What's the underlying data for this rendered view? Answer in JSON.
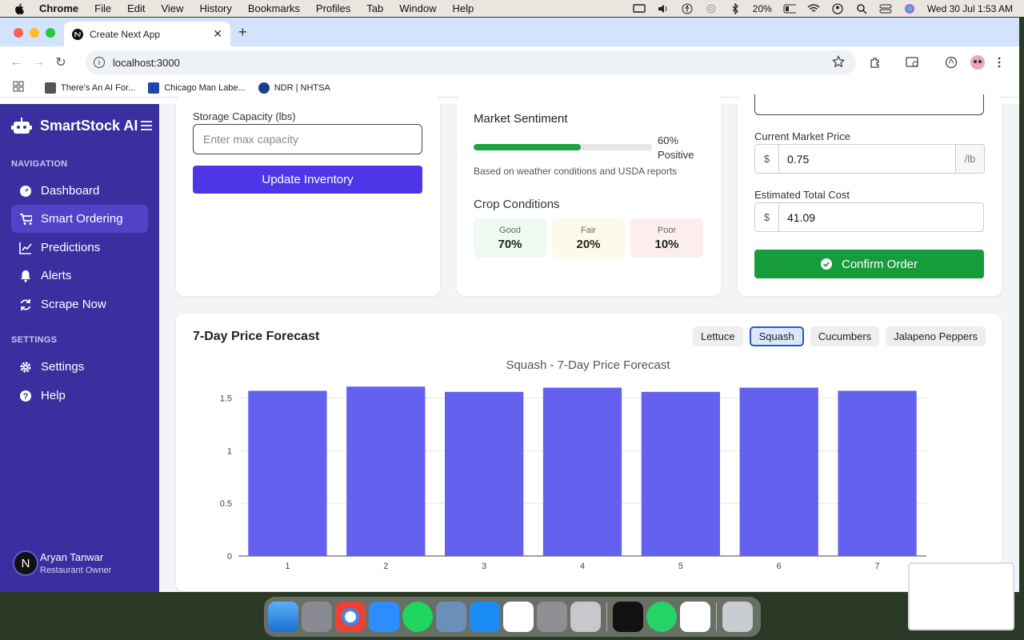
{
  "menubar": {
    "app": "Chrome",
    "items": [
      "File",
      "Edit",
      "View",
      "History",
      "Bookmarks",
      "Profiles",
      "Tab",
      "Window",
      "Help"
    ],
    "battery": "20%",
    "datetime": "Wed 30 Jul  1:53 AM"
  },
  "browser": {
    "tab_title": "Create Next App",
    "url": "localhost:3000",
    "bookmarks": [
      "There's An AI For...",
      "Chicago Man Labe...",
      "NDR | NHTSA"
    ]
  },
  "sidebar": {
    "brand": "SmartStock AI",
    "nav_heading": "NAVIGATION",
    "nav_items": [
      {
        "label": "Dashboard",
        "icon": "dashboard-icon"
      },
      {
        "label": "Smart Ordering",
        "icon": "cart-icon"
      },
      {
        "label": "Predictions",
        "icon": "chart-line-icon"
      },
      {
        "label": "Alerts",
        "icon": "bell-icon"
      },
      {
        "label": "Scrape Now",
        "icon": "refresh-icon"
      }
    ],
    "settings_heading": "SETTINGS",
    "settings_items": [
      {
        "label": "Settings",
        "icon": "gear-icon"
      },
      {
        "label": "Help",
        "icon": "help-icon"
      }
    ],
    "user": {
      "initial": "N",
      "name": "Aryan Tanwar",
      "role": "Restaurant Owner"
    }
  },
  "inventory": {
    "storage_label": "Storage Capacity (lbs)",
    "storage_placeholder": "Enter max capacity",
    "update_button": "Update Inventory"
  },
  "market": {
    "sentiment_title": "Market Sentiment",
    "sentiment_percent": "60%",
    "sentiment_value": 0.6,
    "sentiment_word": "Positive",
    "sentiment_note": "Based on weather conditions and USDA reports",
    "conditions_title": "Crop Conditions",
    "conditions": [
      {
        "label": "Good",
        "value": "70%"
      },
      {
        "label": "Fair",
        "value": "20%"
      },
      {
        "label": "Poor",
        "value": "10%"
      }
    ]
  },
  "order": {
    "price_label": "Current Market Price",
    "price_prefix": "$",
    "price_value": "0.75",
    "price_suffix": "/lb",
    "total_label": "Estimated Total Cost",
    "total_prefix": "$",
    "total_value": "41.09",
    "confirm_button": "Confirm Order"
  },
  "forecast": {
    "title": "7-Day Price Forecast",
    "tabs": [
      "Lettuce",
      "Squash",
      "Cucumbers",
      "Jalapeno Peppers"
    ],
    "selected_tab": "Squash"
  },
  "chart_data": {
    "type": "bar",
    "title": "Squash - 7-Day Price Forecast",
    "categories": [
      "1",
      "2",
      "3",
      "4",
      "5",
      "6",
      "7"
    ],
    "values": [
      1.57,
      1.61,
      1.56,
      1.6,
      1.56,
      1.6,
      1.57
    ],
    "ylim": [
      0,
      1.65
    ],
    "yticks": [
      0,
      0.5,
      1,
      1.5
    ],
    "ytick_labels": [
      "0",
      "0.5",
      "1",
      "1.5"
    ],
    "grid": true,
    "color": "#6461ee"
  }
}
